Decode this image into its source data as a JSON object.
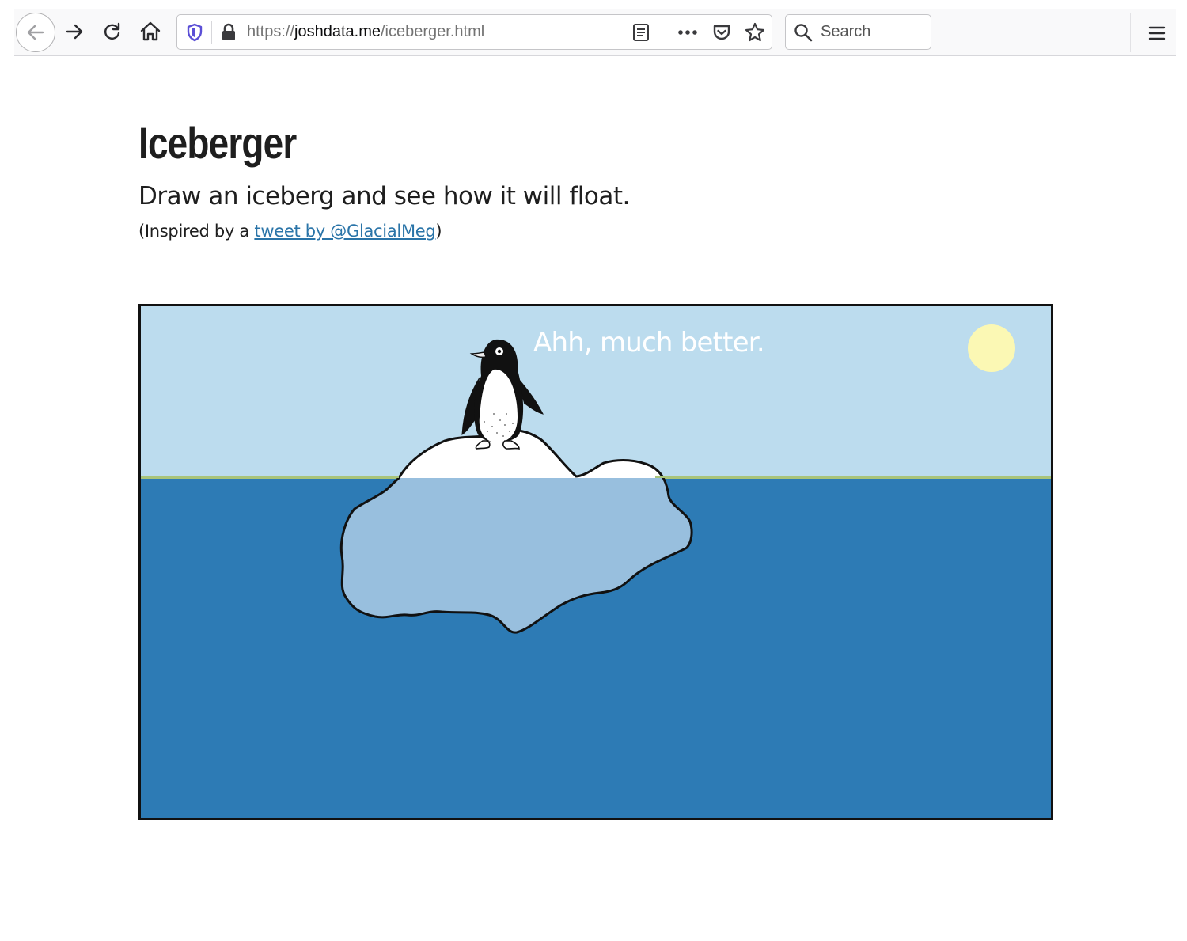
{
  "browser": {
    "url_prefix": "https://",
    "url_host": "joshdata.me",
    "url_path": "/iceberger.html",
    "search_placeholder": "Search",
    "icons": {
      "back": "back-arrow-icon",
      "forward": "forward-arrow-icon",
      "reload": "reload-icon",
      "home": "home-icon",
      "tracking": "shield-icon",
      "lock": "lock-icon",
      "reader": "reader-view-icon",
      "more": "more-actions-icon",
      "pocket": "pocket-icon",
      "bookmark": "star-icon",
      "search": "search-icon",
      "menu": "hamburger-menu-icon"
    }
  },
  "page": {
    "title": "Iceberger",
    "subtitle": "Draw an iceberg and see how it will float.",
    "inspired_prefix": "(Inspired by a ",
    "inspired_link": "tweet by @GlacialMeg",
    "inspired_suffix": ")"
  },
  "scene": {
    "message": "Ahh, much better.",
    "colors": {
      "sky": "#bcdcee",
      "water": "#2d7bb5",
      "waterline": "#a9c47a",
      "ice_above": "#ffffff",
      "ice_below": "#98bfde",
      "outline": "#111111",
      "sun": "#fbf8b4"
    }
  }
}
